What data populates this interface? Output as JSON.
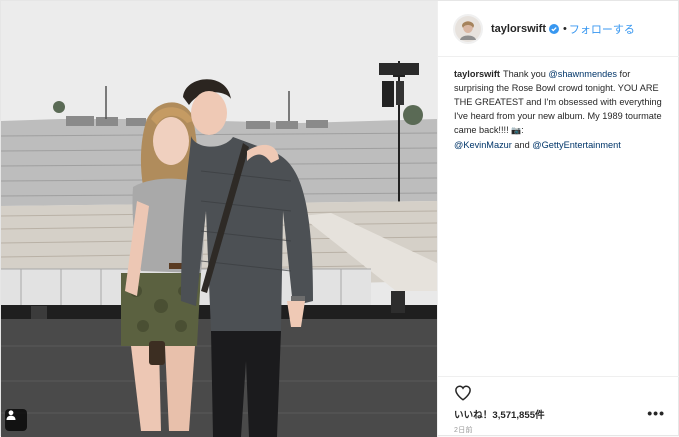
{
  "post": {
    "author": "taylorswift",
    "follow_label": "フォローする",
    "dot": "•",
    "caption": {
      "username": "taylorswift",
      "text_1": "Thank you ",
      "mention_1": "@shawnmendes",
      "text_2": " for surprising the Rose Bowl crowd tonight. YOU ARE THE GREATEST and I'm obsessed with everything I've heard from your new album. My 1989 tourmate came back!!!! ",
      "camera_icon": "📷",
      "text_3": ": ",
      "mention_2": "@KevinMazur",
      "text_4": " and ",
      "mention_3": "@GettyEntertainment"
    },
    "likes_label": "いいね！3,571,855件",
    "time_label": "2日前",
    "more_label": "•••"
  },
  "icons": {
    "verified": "verified-badge-icon",
    "heart": "heart-icon",
    "tag": "user-tag-icon",
    "more": "more-options-icon"
  },
  "colors": {
    "link": "#3897f0",
    "mention": "#003569",
    "text": "#262626",
    "muted": "#999999"
  }
}
